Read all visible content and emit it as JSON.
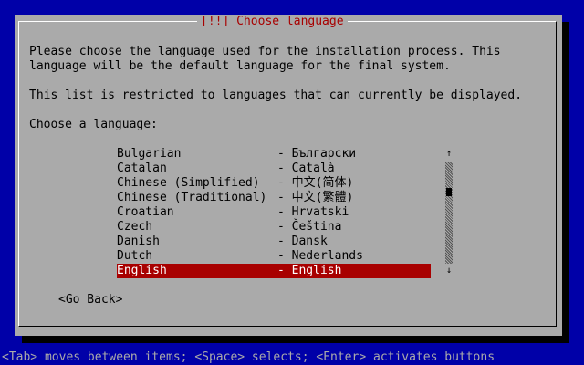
{
  "dialog": {
    "title": "[!!] Choose language",
    "intro_line1": "Please choose the language used for the installation process. This",
    "intro_line2": "language will be the default language for the final system.",
    "restriction_note": "This list is restricted to languages that can currently be displayed.",
    "prompt": "Choose a language:",
    "scroll_up_glyph": "↑",
    "scroll_down_glyph": "↓",
    "scroll_thumb_fraction_start": 0.26,
    "scroll_thumb_fraction_size": 0.08,
    "languages": [
      {
        "name": "Bulgarian",
        "native": "- Български",
        "selected": false
      },
      {
        "name": "Catalan",
        "native": "- Català",
        "selected": false
      },
      {
        "name": "Chinese (Simplified)",
        "native": "- 中文(简体)",
        "selected": false
      },
      {
        "name": "Chinese (Traditional)",
        "native": "- 中文(繁體)",
        "selected": false
      },
      {
        "name": "Croatian",
        "native": "- Hrvatski",
        "selected": false
      },
      {
        "name": "Czech",
        "native": "- Čeština",
        "selected": false
      },
      {
        "name": "Danish",
        "native": "- Dansk",
        "selected": false
      },
      {
        "name": "Dutch",
        "native": "- Nederlands",
        "selected": false
      },
      {
        "name": "English",
        "native": "- English",
        "selected": true
      }
    ],
    "go_back_label": "<Go Back>"
  },
  "status_bar": {
    "text": "<Tab> moves between items; <Space> selects; <Enter> activates buttons"
  },
  "colors": {
    "background": "#0000a8",
    "dialog": "#aaaaaa",
    "title": "#a80000",
    "selection": "#a80000"
  }
}
